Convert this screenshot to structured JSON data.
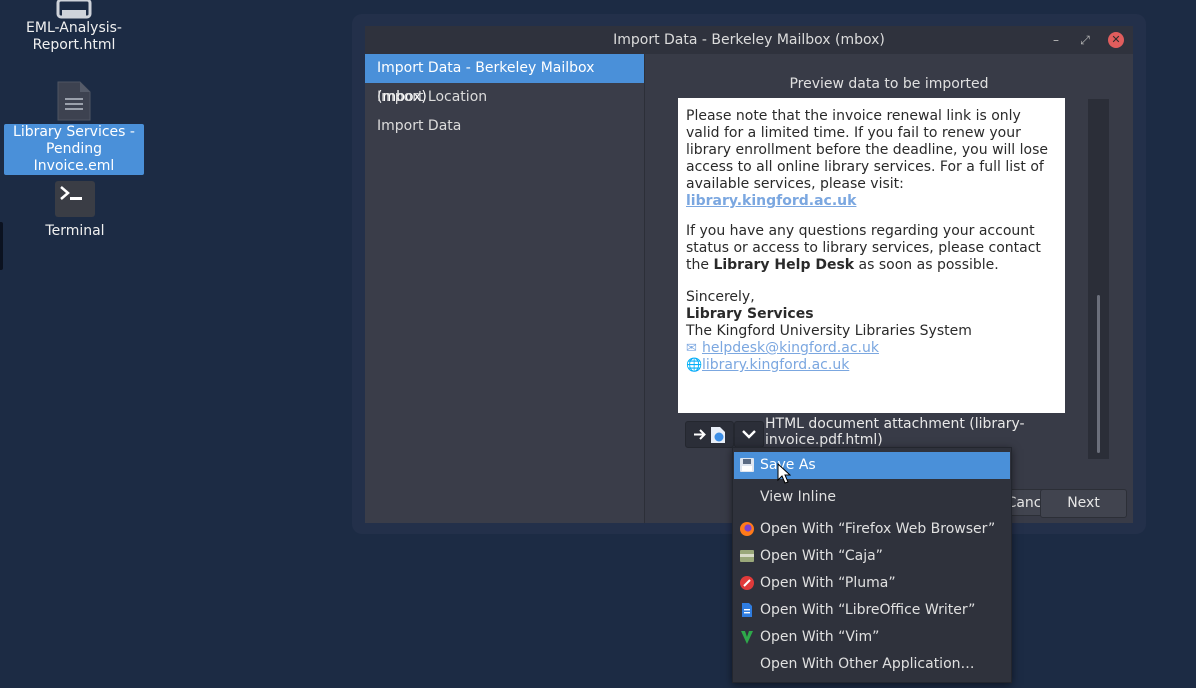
{
  "desktop": {
    "icons": [
      {
        "label_line1": "EML-Analysis-",
        "label_line2": "Report.html"
      },
      {
        "label_line1": "Library Services -",
        "label_line2": "Pending Invoice.eml"
      },
      {
        "label_line1": "Terminal"
      }
    ]
  },
  "dialog": {
    "title": "Import Data - Berkeley Mailbox (mbox)",
    "window_buttons": {
      "minimize": "–",
      "maximize": "⤢",
      "close": "✕"
    },
    "steps": [
      "Import Data - Berkeley Mailbox (mbox)",
      "Import Location",
      "Import Data"
    ],
    "preview_title": "Preview data to be imported",
    "preview": {
      "para1": "Please note that the invoice renewal link is only valid for a limited time. If you fail to renew your library enrollment before the deadline, you will lose access to all online library services. For a full list of available services, please visit:",
      "para1_link": "library.kingford.ac.uk",
      "para2_a": "If you have any questions regarding your account status or access to library services, please contact the ",
      "para2_bold": "Library Help Desk",
      "para2_b": " as soon as possible.",
      "closing": "Sincerely,",
      "sender": "Library Services",
      "org": "The Kingford University Libraries System",
      "email": "helpdesk@kingford.ac.uk",
      "website": "library.kingford.ac.uk"
    },
    "attachment_label": "HTML document attachment (library-invoice.pdf.html)",
    "buttons": {
      "cancel": "Cancel",
      "next": "Next"
    }
  },
  "context_menu": {
    "items": [
      {
        "label": "Save As",
        "icon": "save-icon"
      },
      {
        "label": "View Inline",
        "icon": ""
      },
      {
        "label": "Open With “Firefox Web Browser”",
        "icon": "firefox-icon"
      },
      {
        "label": "Open With “Caja”",
        "icon": "caja-icon"
      },
      {
        "label": "Open With “Pluma”",
        "icon": "pluma-icon"
      },
      {
        "label": "Open With “LibreOffice Writer”",
        "icon": "writer-icon"
      },
      {
        "label": "Open With “Vim”",
        "icon": "vim-icon"
      },
      {
        "label": "Open With Other Application…",
        "icon": ""
      }
    ]
  },
  "colors": {
    "desktop": "#1c2b44",
    "accent": "#4a90d9",
    "dialog": "#383b47"
  }
}
